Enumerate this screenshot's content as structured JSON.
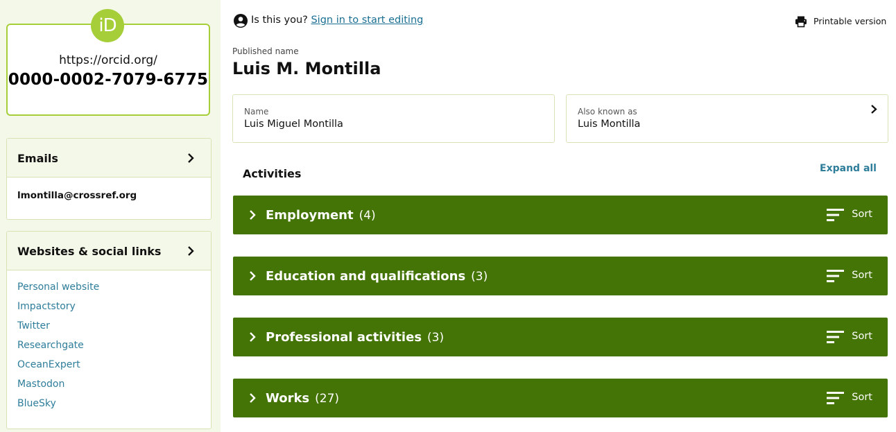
{
  "sidebar": {
    "orcid_logo": "iD",
    "orcid_url": "https://orcid.org/",
    "orcid_id": "0000-0002-7079-6775",
    "emails": {
      "title": "Emails",
      "value": "lmontilla@crossref.org"
    },
    "websites": {
      "title": "Websites & social links",
      "links": [
        "Personal website",
        "Impactstory",
        "Twitter",
        "Researchgate",
        "OceanExpert",
        "Mastodon",
        "BlueSky"
      ]
    }
  },
  "topbar": {
    "prompt": "Is this you?",
    "signin_link": "Sign in to start editing",
    "printable": "Printable version"
  },
  "profile": {
    "published_label": "Published name",
    "published_name": "Luis M. Montilla",
    "name_label": "Name",
    "name_value": "Luis Miguel Montilla",
    "aka_label": "Also known as",
    "aka_value": "Luis Montilla"
  },
  "activities": {
    "title": "Activities",
    "expand_all": "Expand all",
    "sections": [
      {
        "title": "Employment",
        "count": "(4)",
        "sort": "Sort"
      },
      {
        "title": "Education and qualifications",
        "count": "(3)",
        "sort": "Sort"
      },
      {
        "title": "Professional activities",
        "count": "(3)",
        "sort": "Sort"
      },
      {
        "title": "Works",
        "count": "(27)",
        "sort": "Sort"
      }
    ]
  },
  "colors": {
    "orcid_green": "#a6ce39",
    "section_bar": "#447405",
    "link": "#2e7d9a",
    "sidebar_bg": "#f4f8e8"
  }
}
